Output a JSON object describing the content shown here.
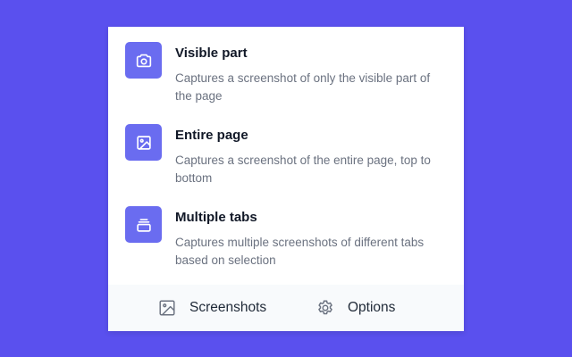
{
  "colors": {
    "background": "#5a50ee",
    "accent": "#6a6cf0",
    "panel": "#ffffff",
    "footer": "#f8fafc"
  },
  "options": [
    {
      "icon": "camera-icon",
      "title": "Visible part",
      "description": "Captures a screenshot of only the visible part of the page"
    },
    {
      "icon": "image-icon",
      "title": "Entire page",
      "description": "Captures a screenshot of the entire page, top to bottom"
    },
    {
      "icon": "tabs-stack-icon",
      "title": "Multiple tabs",
      "description": "Captures multiple screenshots of different tabs based on selection"
    }
  ],
  "footer": {
    "screenshots": {
      "icon": "image-icon",
      "label": "Screenshots"
    },
    "options": {
      "icon": "gear-icon",
      "label": "Options"
    }
  }
}
